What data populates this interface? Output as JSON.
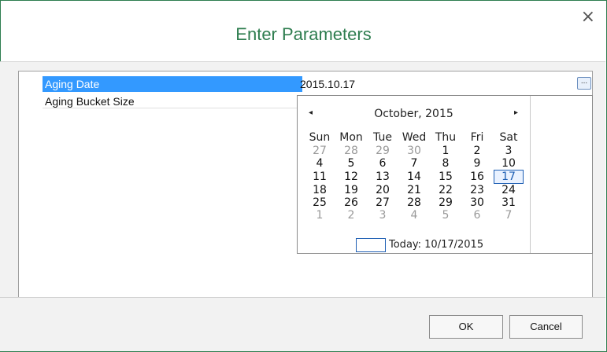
{
  "dialog": {
    "title": "Enter Parameters",
    "close_icon": "×"
  },
  "properties": [
    {
      "name": "Aging Date",
      "value": "2015.10.17",
      "button": "..."
    },
    {
      "name": "Aging Bucket Size",
      "value": ""
    }
  ],
  "calendar": {
    "prev": "◂",
    "next": "▸",
    "month_year": "October, 2015",
    "weekdays": [
      "Sun",
      "Mon",
      "Tue",
      "Wed",
      "Thu",
      "Fri",
      "Sat"
    ],
    "weeks": [
      [
        "27",
        "28",
        "29",
        "30",
        "1",
        "2",
        "3"
      ],
      [
        "4",
        "5",
        "6",
        "7",
        "8",
        "9",
        "10"
      ],
      [
        "11",
        "12",
        "13",
        "14",
        "15",
        "16",
        "17"
      ],
      [
        "18",
        "19",
        "20",
        "21",
        "22",
        "23",
        "24"
      ],
      [
        "25",
        "26",
        "27",
        "28",
        "29",
        "30",
        "31"
      ],
      [
        "1",
        "2",
        "3",
        "4",
        "5",
        "6",
        "7"
      ]
    ],
    "selected_day": "17",
    "today_label": "Today: 10/17/2015"
  },
  "buttons": {
    "ok": "OK",
    "cancel": "Cancel"
  }
}
